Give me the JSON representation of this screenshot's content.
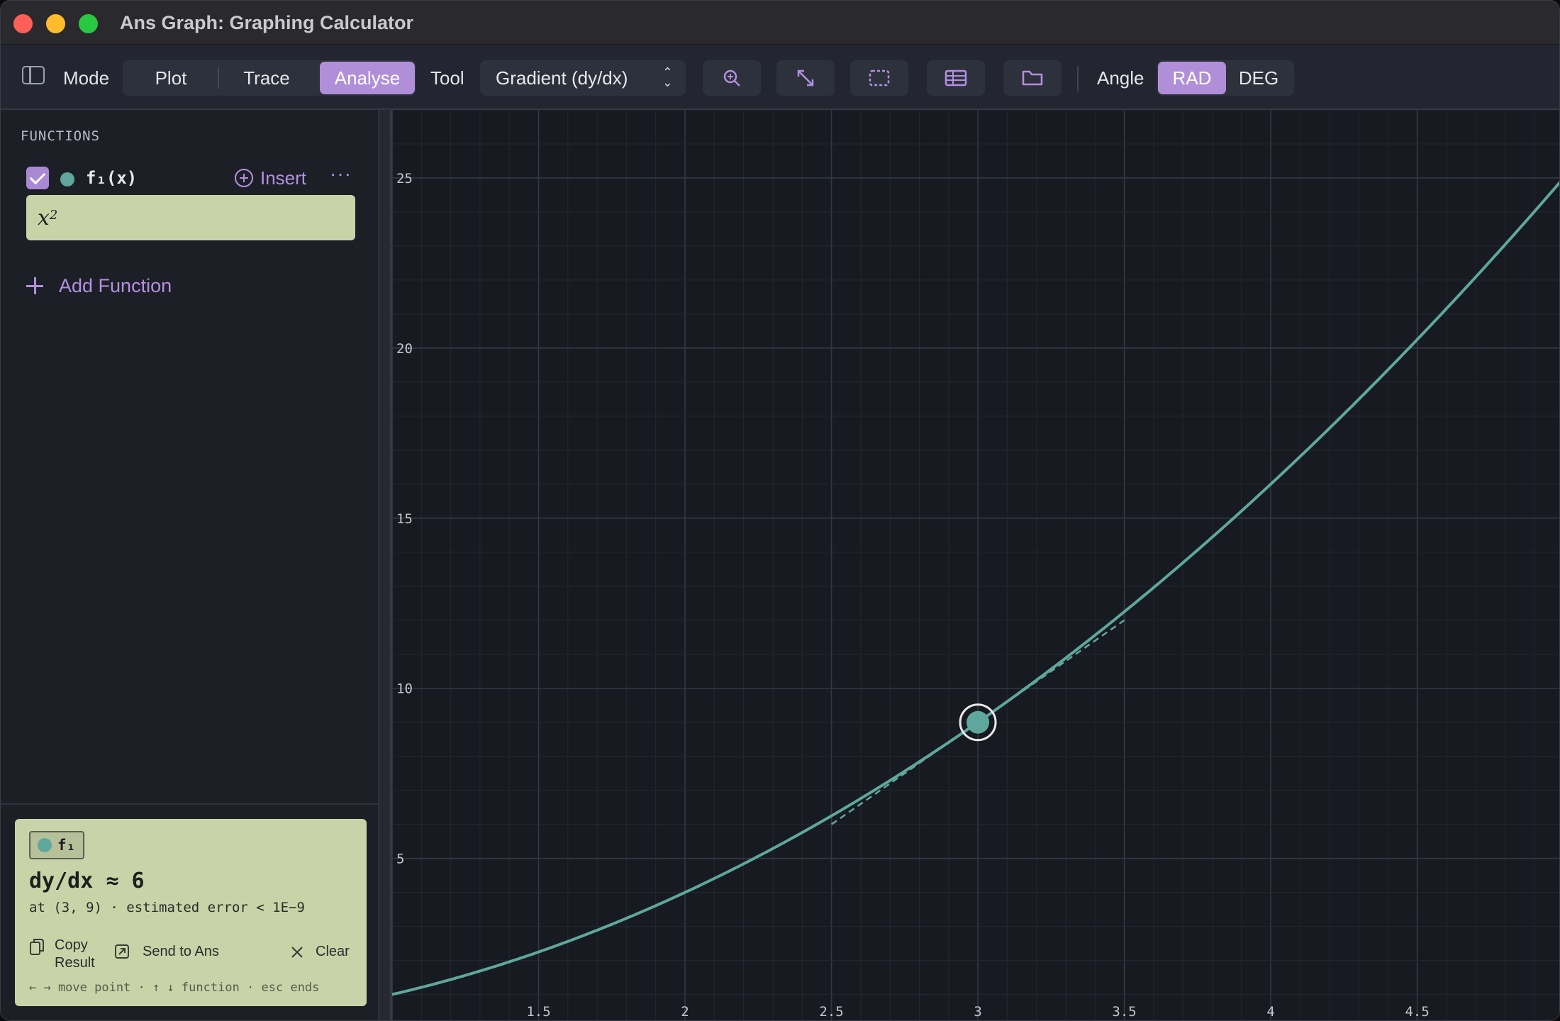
{
  "window": {
    "title": "Ans Graph: Graphing Calculator"
  },
  "toolbar": {
    "mode_label": "Mode",
    "modes": [
      "Plot",
      "Trace",
      "Analyse"
    ],
    "active_mode": "Analyse",
    "tool_label": "Tool",
    "tool_value": "Gradient (dy/dx)",
    "angle_label": "Angle",
    "angle_options": [
      "RAD",
      "DEG"
    ],
    "active_angle": "RAD",
    "icons": [
      "zoom-icon",
      "fit-icon",
      "select-region-icon",
      "table-icon",
      "folder-icon"
    ]
  },
  "sidebar": {
    "section_title": "FUNCTIONS",
    "functions": [
      {
        "name": "f₁(x)",
        "expression": "x",
        "exponent": "2",
        "enabled": true,
        "color": "#5fa79c"
      }
    ],
    "insert_label": "Insert",
    "more_label": "···",
    "add_function_label": "Add Function"
  },
  "result": {
    "chip_label": "f₁",
    "main": "dy/dx ≈ 6",
    "sub": "at (3, 9) · estimated error < 1E−9",
    "copy_label_1": "Copy",
    "copy_label_2": "Result",
    "send_label": "Send to Ans",
    "clear_label": "Clear",
    "hint": "← → move point · ↑ ↓ function · esc ends"
  },
  "colors": {
    "accent": "#b08fd8",
    "curve": "#5fa79c",
    "result_bg": "#c8d4a8"
  },
  "chart_data": {
    "type": "line",
    "function": "x^2",
    "xlim": [
      1.0,
      4.99
    ],
    "ylim": [
      0.2,
      27.0
    ],
    "x_ticks": [
      1.5,
      2,
      2.5,
      3,
      3.5,
      4,
      4.5
    ],
    "x_tick_labels": [
      "1.5",
      "2",
      "2.5",
      "3",
      "3.5",
      "4",
      "4.5"
    ],
    "y_ticks": [
      5,
      10,
      15,
      20,
      25
    ],
    "y_tick_labels": [
      "5",
      "10",
      "15",
      "20",
      "25"
    ],
    "grid": true,
    "marked_point": {
      "x": 3,
      "y": 9
    },
    "tangent": {
      "slope": 6,
      "x_from": 2.5,
      "x_to": 3.5
    }
  }
}
